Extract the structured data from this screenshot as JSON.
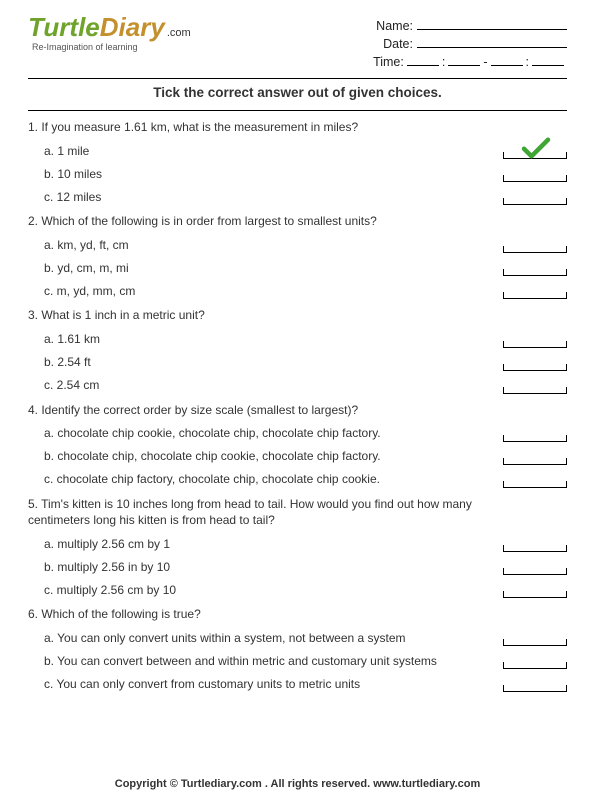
{
  "logo": {
    "word1": "Turtle",
    "word2": "Diary",
    "dotcom": ".com",
    "tagline": "Re-Imagination of learning"
  },
  "header_fields": {
    "name_label": "Name:",
    "date_label": "Date:",
    "time_label": "Time:",
    "colon": ":",
    "dash": "-"
  },
  "instruction": "Tick the correct answer out of given choices.",
  "questions": [
    {
      "num": "1.",
      "text": "If you measure 1.61 km, what is the measurement in miles?",
      "choices": [
        {
          "label": "a. 1 mile",
          "ticked": true
        },
        {
          "label": "b. 10 miles",
          "ticked": false
        },
        {
          "label": "c. 12 miles",
          "ticked": false
        }
      ]
    },
    {
      "num": "2.",
      "text": "Which of the following is in order from largest to smallest units?",
      "choices": [
        {
          "label": "a. km, yd, ft, cm",
          "ticked": false
        },
        {
          "label": "b. yd, cm, m, mi",
          "ticked": false
        },
        {
          "label": "c. m, yd, mm, cm",
          "ticked": false
        }
      ]
    },
    {
      "num": "3.",
      "text": "What is 1 inch in a metric unit?",
      "choices": [
        {
          "label": "a. 1.61 km",
          "ticked": false
        },
        {
          "label": "b. 2.54 ft",
          "ticked": false
        },
        {
          "label": "c. 2.54 cm",
          "ticked": false
        }
      ]
    },
    {
      "num": "4.",
      "text": "Identify the correct order by size scale (smallest to largest)?",
      "choices": [
        {
          "label": "a. chocolate chip cookie, chocolate chip, chocolate chip factory.",
          "ticked": false
        },
        {
          "label": "b. chocolate chip, chocolate chip cookie, chocolate chip factory.",
          "ticked": false
        },
        {
          "label": "c. chocolate chip factory, chocolate chip, chocolate chip cookie.",
          "ticked": false
        }
      ]
    },
    {
      "num": "5.",
      "text": "Tim's kitten is 10 inches long from head to tail. How would you find out how many centimeters long his kitten is from head to tail?",
      "choices": [
        {
          "label": "a. multiply 2.56 cm by 1",
          "ticked": false
        },
        {
          "label": "b. multiply 2.56 in by 10",
          "ticked": false
        },
        {
          "label": "c. multiply 2.56 cm by 10",
          "ticked": false
        }
      ]
    },
    {
      "num": "6.",
      "text": "Which of the following is true?",
      "choices": [
        {
          "label": "a. You can only convert units within a system, not between a system",
          "ticked": false
        },
        {
          "label": "b. You can convert between and within metric and customary unit systems",
          "ticked": false
        },
        {
          "label": "c. You can only convert from customary units to metric units",
          "ticked": false
        }
      ]
    }
  ],
  "footer": "Copyright © Turtlediary.com . All rights reserved. www.turtlediary.com"
}
